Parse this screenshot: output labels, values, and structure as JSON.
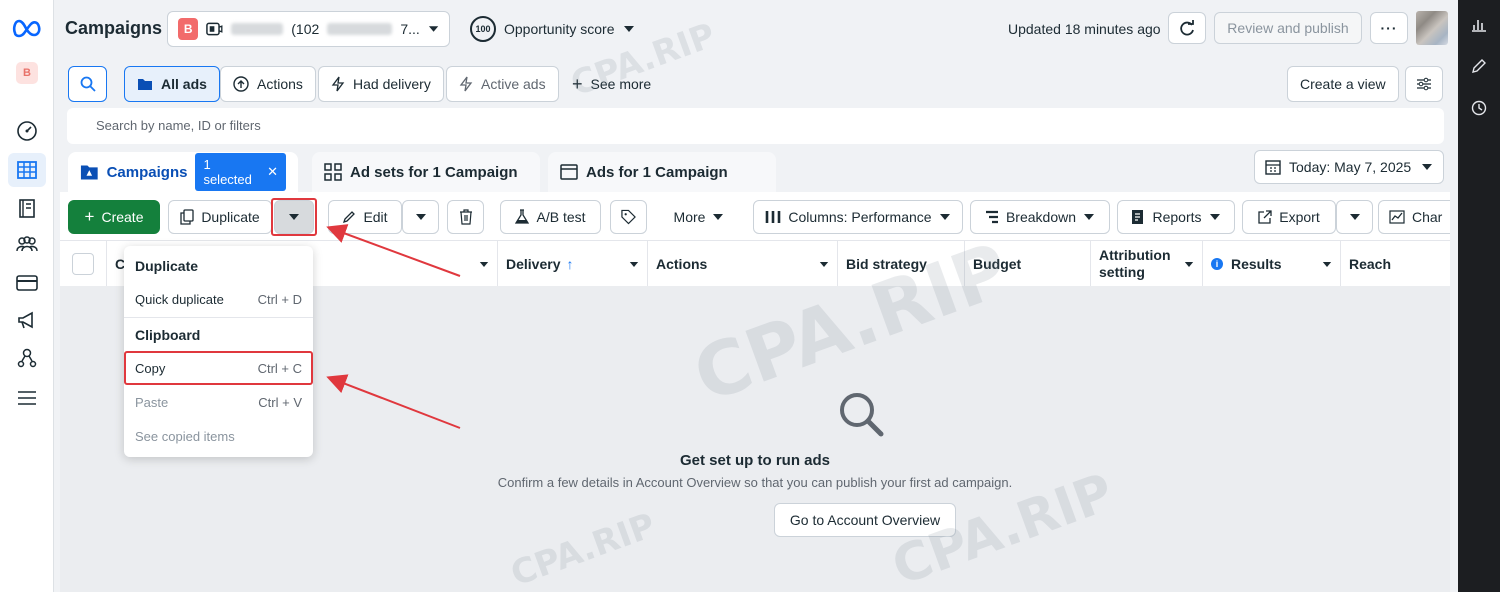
{
  "header": {
    "title": "Campaigns",
    "account_badge": "B",
    "account_id_prefix": "(102",
    "account_id_suffix": "7...",
    "opportunity_score_value": "100",
    "opportunity_score_label": "Opportunity score",
    "updated": "Updated 18 minutes ago",
    "review_publish": "Review and publish",
    "more": "···"
  },
  "left_rail": {
    "account_badge": "B"
  },
  "filters": {
    "all_ads": "All ads",
    "actions": "Actions",
    "had_delivery": "Had delivery",
    "active_ads": "Active ads",
    "see_more": "See more",
    "create_view": "Create a view",
    "search_placeholder": "Search by name, ID or filters"
  },
  "tabs": {
    "campaigns": "Campaigns",
    "selected_chip": "1 selected",
    "ad_sets": "Ad sets for 1 Campaign",
    "ads": "Ads for 1 Campaign",
    "date": "Today: May 7, 2025"
  },
  "toolbar": {
    "create": "Create",
    "duplicate": "Duplicate",
    "edit": "Edit",
    "ab_test": "A/B test",
    "more": "More",
    "columns": "Columns: Performance",
    "breakdown": "Breakdown",
    "reports": "Reports",
    "export": "Export",
    "charts": "Char"
  },
  "table": {
    "columns": {
      "campaign_initial": "C",
      "delivery": "Delivery",
      "actions": "Actions",
      "bid_strategy": "Bid strategy",
      "budget": "Budget",
      "attribution_line1": "Attribution",
      "attribution_line2": "setting",
      "results": "Results",
      "reach": "Reach"
    }
  },
  "empty_state": {
    "title": "Get set up to run ads",
    "subtitle": "Confirm a few details in Account Overview so that you can publish your first ad campaign.",
    "button": "Go to Account Overview"
  },
  "dropdown": {
    "duplicate_header": "Duplicate",
    "quick_duplicate": "Quick duplicate",
    "quick_duplicate_shortcut": "Ctrl + D",
    "clipboard_header": "Clipboard",
    "copy": "Copy",
    "copy_shortcut": "Ctrl + C",
    "paste": "Paste",
    "paste_shortcut": "Ctrl + V",
    "see_copied": "See copied items"
  },
  "watermark": "CPA.RIP",
  "colors": {
    "accent_blue": "#1877f2",
    "create_green": "#14803c",
    "highlight_red": "#e0383e"
  }
}
